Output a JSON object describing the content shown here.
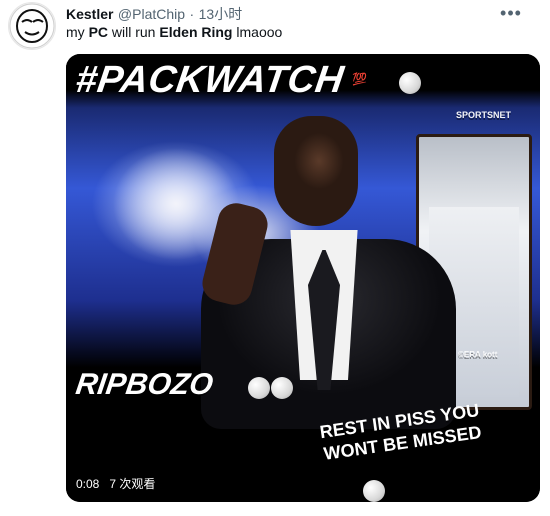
{
  "tweet": {
    "author_name": "Kestler",
    "author_handle": "@PlatChip",
    "dot": "·",
    "time": "13小时",
    "more_icon": "more-icon",
    "text_pre": "my ",
    "text_pc": "PC",
    "text_mid": " will run ",
    "text_game": "Elden Ring",
    "text_post": " lmaooo"
  },
  "video": {
    "headline": "#PACKWATCH",
    "rip": "RIPBOZO",
    "caption_line1": "REST IN PISS YOU",
    "caption_line2": "WONT BE MISSED",
    "network_tag": "SPORTSNET",
    "era_tag": "©ERA kott",
    "hundred_emoji": "💯",
    "duration": "0:08",
    "views": "7 次观看"
  }
}
